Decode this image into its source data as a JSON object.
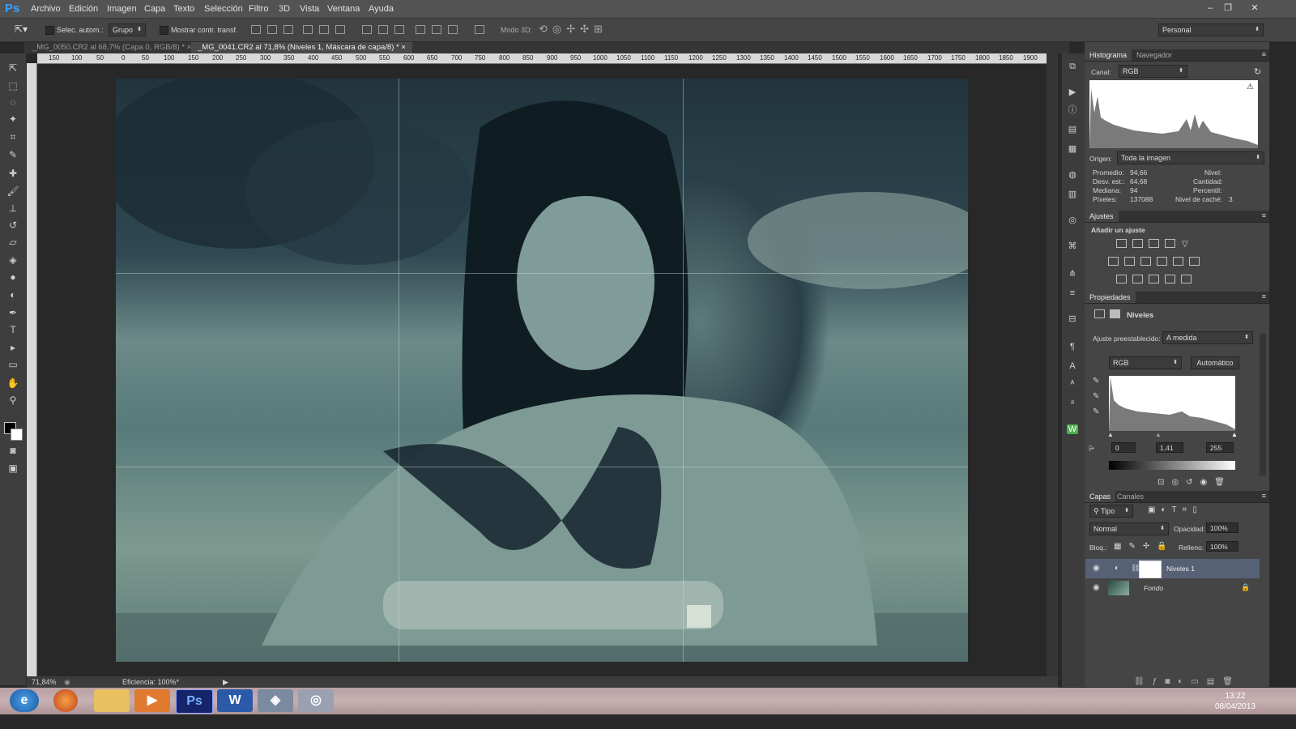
{
  "app": {
    "logo": "Ps",
    "menus": [
      "Archivo",
      "Edición",
      "Imagen",
      "Capa",
      "Texto",
      "Selección",
      "Filtro",
      "3D",
      "Vista",
      "Ventana",
      "Ayuda"
    ],
    "window_buttons": [
      "–",
      "❐",
      "✕"
    ]
  },
  "options": {
    "auto_select_label": "Selec. autom.:",
    "auto_select_value": "Grupo",
    "show_transform_label": "Mostrar contr. transf.",
    "mode3d_label": "Modo 3D:",
    "workspace": "Personal"
  },
  "tabs": [
    {
      "label": "_MG_0050.CR2 al 68,7% (Capa 0, RGB/8) *",
      "active": false
    },
    {
      "label": "_MG_0041.CR2 al 71,8% (Niveles 1, Máscara de capa/8) *",
      "active": true
    }
  ],
  "ruler": [
    "150",
    "100",
    "50",
    "0",
    "50",
    "100",
    "150",
    "200",
    "250",
    "300",
    "350",
    "400",
    "450",
    "500",
    "550",
    "600",
    "650",
    "700",
    "750",
    "800",
    "850",
    "900",
    "950",
    "1000",
    "1050",
    "1100",
    "1150",
    "1200",
    "1250",
    "1300",
    "1350",
    "1400",
    "1450",
    "1500",
    "1550",
    "1600",
    "1650",
    "1700",
    "1750",
    "1800",
    "1850",
    "1900"
  ],
  "status": {
    "zoom": "71,84%",
    "info": "Eficiencia: 100%*"
  },
  "histogram": {
    "tabs": [
      "Histograma",
      "Navegador"
    ],
    "channel_label": "Canal:",
    "channel": "RGB",
    "source_label": "Origen:",
    "source": "Toda la imagen",
    "stats_left": [
      [
        "Promedio:",
        "94,66"
      ],
      [
        "Desv. est.:",
        "64,68"
      ],
      [
        "Mediana:",
        "94"
      ],
      [
        "Píxeles:",
        "137088"
      ]
    ],
    "stats_right": [
      [
        "Nivel:",
        ""
      ],
      [
        "Cantidad:",
        ""
      ],
      [
        "Percentil:",
        ""
      ],
      [
        "Nivel de caché:",
        "3"
      ]
    ]
  },
  "adjustments": {
    "title": "Ajustes",
    "subtitle": "Añadir un ajuste"
  },
  "properties": {
    "title": "Propiedades",
    "name": "Niveles",
    "preset_label": "Ajuste preestablecido:",
    "preset": "A medida",
    "channel": "RGB",
    "auto": "Automático",
    "input_values": [
      "0",
      "1,41",
      "255"
    ]
  },
  "layers": {
    "tabs": [
      "Capas",
      "Canales"
    ],
    "filter": "Tipo",
    "blend": "Normal",
    "opacity_label": "Opacidad:",
    "opacity": "100%",
    "lock_label": "Bloq.:",
    "fill_label": "Relleno:",
    "fill": "100%",
    "items": [
      {
        "name": "Niveles 1",
        "selected": true
      },
      {
        "name": "Fondo",
        "selected": false
      }
    ]
  },
  "taskbar": {
    "time": "13:22",
    "date": "08/04/2013"
  }
}
